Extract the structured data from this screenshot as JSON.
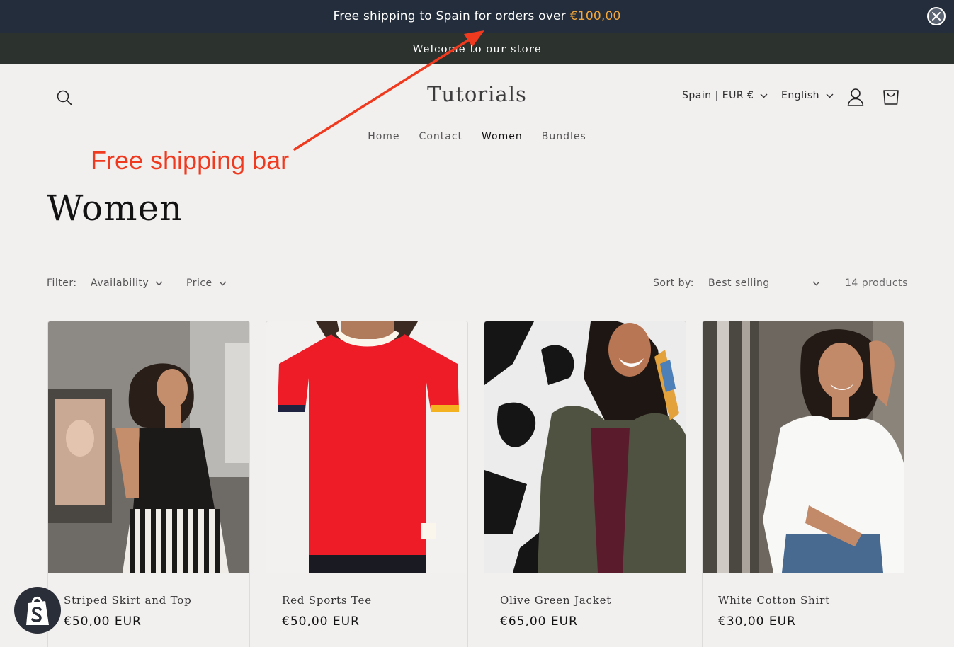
{
  "shipping_bar": {
    "text": "Free shipping to Spain for orders over",
    "amount": "€100,00",
    "close_icon": "close-icon"
  },
  "announcement": {
    "text": "Welcome to our store"
  },
  "header": {
    "logo": "Tutorials",
    "country": "Spain | EUR €",
    "language": "English",
    "icons": [
      "search-icon",
      "account-icon",
      "cart-icon",
      "chevron-down-icon"
    ]
  },
  "nav": {
    "items": [
      {
        "label": "Home"
      },
      {
        "label": "Contact"
      },
      {
        "label": "Women",
        "active": true
      },
      {
        "label": "Bundles"
      }
    ]
  },
  "annotation": {
    "text": "Free shipping bar",
    "color": "#f03a1f"
  },
  "collection": {
    "title": "Women",
    "filter_label": "Filter:",
    "filters": [
      "Availability",
      "Price"
    ],
    "sort_label": "Sort by:",
    "sort_value": "Best selling",
    "count": "14 products"
  },
  "products": [
    {
      "name": "Striped Skirt and Top",
      "price": "€50,00 EUR"
    },
    {
      "name": "Red Sports Tee",
      "price": "€50,00 EUR"
    },
    {
      "name": "Olive Green Jacket",
      "price": "€65,00 EUR"
    },
    {
      "name": "White Cotton Shirt",
      "price": "€30,00 EUR"
    }
  ],
  "colors": {
    "shipping_bar_bg": "#232d3b",
    "announcement_bg": "#2c332f",
    "amount_accent": "#f2a63b",
    "page_bg": "#f2efef"
  }
}
